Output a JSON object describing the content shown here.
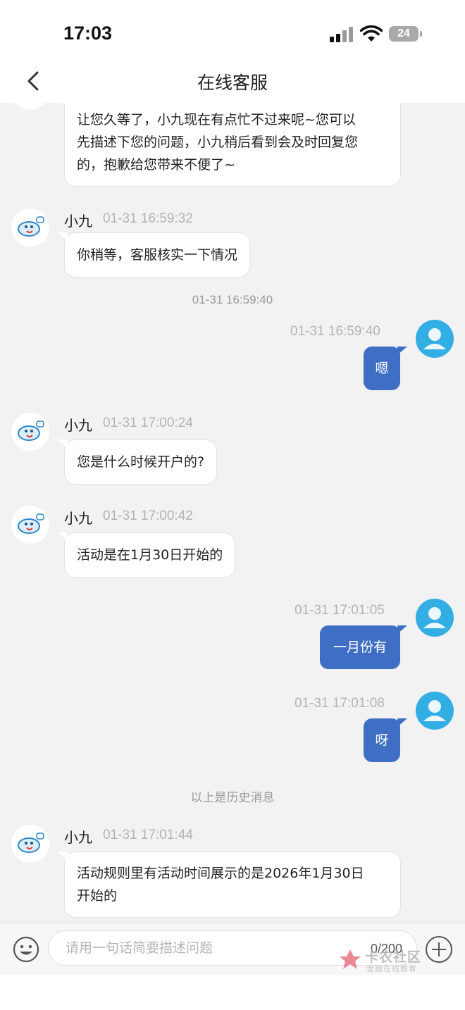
{
  "status_bar": {
    "time": "17:03",
    "battery": "24"
  },
  "header": {
    "title": "在线客服"
  },
  "messages": [
    {
      "type": "bot",
      "text_lines": [
        "让您久等了，小九现在有点忙不过来呢~您可以",
        "先描述下您的问题，小九稍后看到会及时回复您",
        "的，抱歉给您带来不便了~"
      ]
    },
    {
      "type": "bot",
      "sender": "小九",
      "time": "01-31 16:59:32",
      "text": "你稍等，客服核实一下情况"
    },
    {
      "type": "center",
      "text": "01-31 16:59:40"
    },
    {
      "type": "user",
      "time": "01-31 16:59:40",
      "text": "嗯"
    },
    {
      "type": "bot",
      "sender": "小九",
      "time": "01-31 17:00:24",
      "text": "您是什么时候开户的?"
    },
    {
      "type": "bot",
      "sender": "小九",
      "time": "01-31 17:00:42",
      "text": "活动是在1月30日开始的"
    },
    {
      "type": "user",
      "time": "01-31 17:01:05",
      "text": "一月份有"
    },
    {
      "type": "user",
      "time": "01-31 17:01:08",
      "text": "呀"
    },
    {
      "type": "center",
      "text": "以上是历史消息"
    },
    {
      "type": "bot",
      "sender": "小九",
      "time": "01-31 17:01:44",
      "text_lines": [
        "活动规则里有活动时间展示的是2026年1月30日",
        "开始的"
      ]
    }
  ],
  "input": {
    "placeholder": "请用一句话简要描述问题",
    "counter": "0/200"
  },
  "watermark": {
    "name": "卡农社区",
    "sub": "金融在线教育"
  },
  "icons": [
    "back-icon",
    "signal-icon",
    "wifi-icon",
    "battery-icon",
    "bot-avatar-icon",
    "user-avatar-icon",
    "emoji-icon",
    "plus-icon"
  ],
  "colors": {
    "user_bubble": "#3f6fc4",
    "user_avatar": "#33aee5",
    "background": "#f2f2f2"
  }
}
